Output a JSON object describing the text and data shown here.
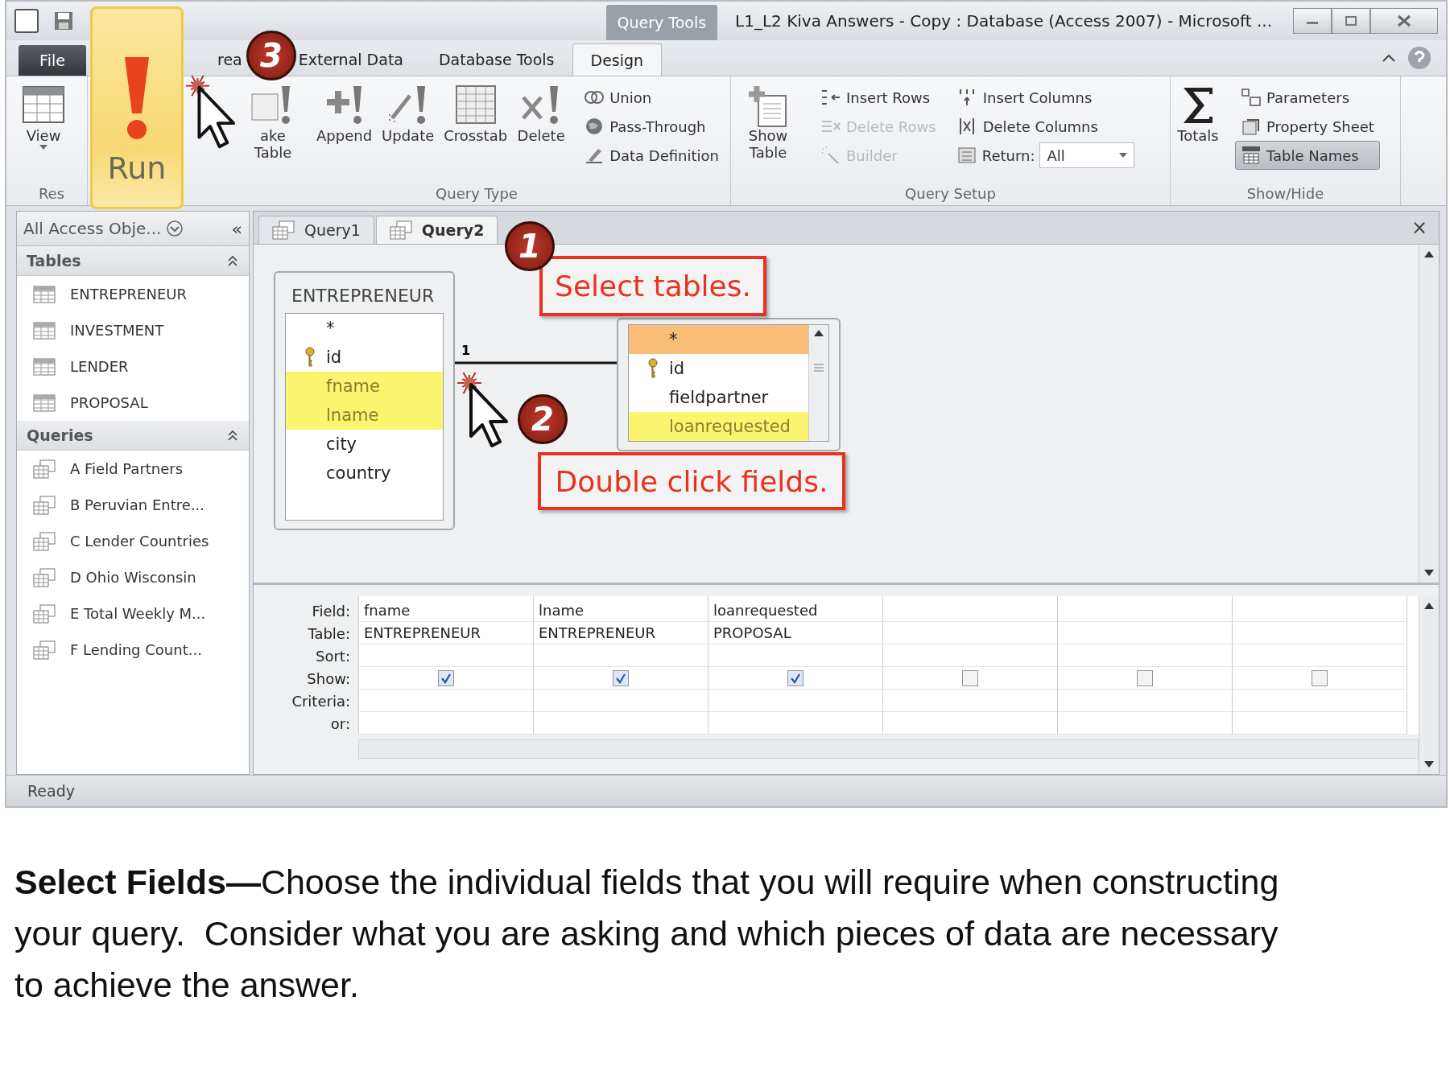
{
  "window": {
    "title": "L1_L2 Kiva Answers - Copy : Database (Access 2007)  -  Microsoft ...",
    "contextual_tab": "Query Tools"
  },
  "tabs": [
    {
      "label": "File",
      "selected": false,
      "kind": "file"
    },
    {
      "label": "rea",
      "selected": false,
      "kind": "tab"
    },
    {
      "label": "External Data",
      "selected": false,
      "kind": "tab"
    },
    {
      "label": "Database Tools",
      "selected": false,
      "kind": "tab"
    },
    {
      "label": "Design",
      "selected": true,
      "kind": "tab"
    }
  ],
  "run_button": {
    "label": "Run",
    "highlighted": true
  },
  "ribbon_groups": [
    {
      "label": "Res",
      "large_buttons": [
        {
          "label": "View",
          "dropdown": true
        }
      ]
    },
    {
      "label": "Query Type",
      "large_buttons": [
        {
          "label": "ake Table",
          "dropdown": false
        },
        {
          "label": "Append",
          "dropdown": false
        },
        {
          "label": "Update",
          "dropdown": false
        },
        {
          "label": "Crosstab",
          "dropdown": false
        },
        {
          "label": "Delete",
          "dropdown": false
        }
      ],
      "small_buttons": [
        {
          "kind": "button",
          "label": "Union",
          "disabled": false,
          "selected": false
        },
        {
          "kind": "button",
          "label": "Pass-Through",
          "disabled": false,
          "selected": false
        },
        {
          "kind": "button",
          "label": "Data Definition",
          "disabled": false,
          "selected": false
        }
      ]
    },
    {
      "label": "Query Setup",
      "large_buttons": [
        {
          "label": "Show Table",
          "dropdown": false
        }
      ],
      "small_buttons": [
        {
          "kind": "button",
          "label": "Insert Rows",
          "disabled": false,
          "selected": false
        },
        {
          "kind": "button",
          "label": "Delete Rows",
          "disabled": true,
          "selected": false
        },
        {
          "kind": "button",
          "label": "Builder",
          "disabled": true,
          "selected": false
        },
        {
          "kind": "button",
          "label": "Insert Columns",
          "disabled": false,
          "selected": false
        },
        {
          "kind": "button",
          "label": "Delete Columns",
          "disabled": false,
          "selected": false
        },
        {
          "kind": "dropdown",
          "label": "Return:",
          "value": "All"
        }
      ]
    },
    {
      "label": "Show/Hide",
      "large_buttons": [
        {
          "label": "Totals",
          "dropdown": false
        }
      ],
      "small_buttons": [
        {
          "kind": "button",
          "label": "Parameters",
          "disabled": false,
          "selected": false
        },
        {
          "kind": "button",
          "label": "Property Sheet",
          "disabled": false,
          "selected": false
        },
        {
          "kind": "button",
          "label": "Table Names",
          "disabled": false,
          "selected": true
        }
      ]
    }
  ],
  "nav_pane": {
    "header": "All Access Obje...",
    "collapse_glyph": "«",
    "sections": [
      {
        "title": "Tables",
        "kind": "table",
        "expanded": true,
        "items": [
          "ENTREPRENEUR",
          "INVESTMENT",
          "LENDER",
          "PROPOSAL"
        ]
      },
      {
        "title": "Queries",
        "kind": "query",
        "expanded": true,
        "items": [
          "A Field Partners",
          "B Peruvian Entre...",
          "C Lender Countries",
          "D Ohio Wisconsin",
          "E Total Weekly M...",
          "F Lending Count..."
        ]
      }
    ]
  },
  "document_tabs": [
    {
      "label": "Query1",
      "selected": false
    },
    {
      "label": "Query2",
      "selected": true
    }
  ],
  "close_glyph": "×",
  "field_lists": [
    {
      "title": "ENTREPRENEUR",
      "scrollbar": false,
      "fields": [
        {
          "name": "*",
          "key": false,
          "current": false,
          "picked": false
        },
        {
          "name": "id",
          "key": true,
          "current": false,
          "picked": false
        },
        {
          "name": "fname",
          "key": false,
          "current": false,
          "picked": true
        },
        {
          "name": "lname",
          "key": false,
          "current": false,
          "picked": true
        },
        {
          "name": "city",
          "key": false,
          "current": false,
          "picked": false
        },
        {
          "name": "country",
          "key": false,
          "current": false,
          "picked": false
        }
      ]
    },
    {
      "scrollbar": true,
      "fields": [
        {
          "name": "*",
          "key": false,
          "current": true,
          "picked": false
        },
        {
          "name": "id",
          "key": true,
          "current": false,
          "picked": false
        },
        {
          "name": "fieldpartner",
          "key": false,
          "current": false,
          "picked": false
        },
        {
          "name": "loanrequested",
          "key": false,
          "current": false,
          "picked": true
        }
      ]
    }
  ],
  "join_label": "1",
  "callouts": [
    {
      "number": "1",
      "text": "Select tables."
    },
    {
      "number": "2",
      "text": "Double click fields."
    },
    {
      "number": "3"
    }
  ],
  "design_grid": {
    "row_labels": [
      "Field:",
      "Table:",
      "Sort:",
      "Show:",
      "Criteria:",
      "or:"
    ],
    "columns": [
      {
        "field": "fname",
        "table": "ENTREPRENEUR",
        "show": true
      },
      {
        "field": "lname",
        "table": "ENTREPRENEUR",
        "show": true
      },
      {
        "field": "loanrequested",
        "table": "PROPOSAL",
        "show": true
      },
      {
        "show": false
      },
      {
        "show": false
      },
      {
        "show": false
      }
    ]
  },
  "status_bar": "Ready",
  "caption": "**Select Fields—**Choose the individual fields that you will require when constructing your query.  Consider what you are asking and which pieces of data are necessary to achieve the answer."
}
